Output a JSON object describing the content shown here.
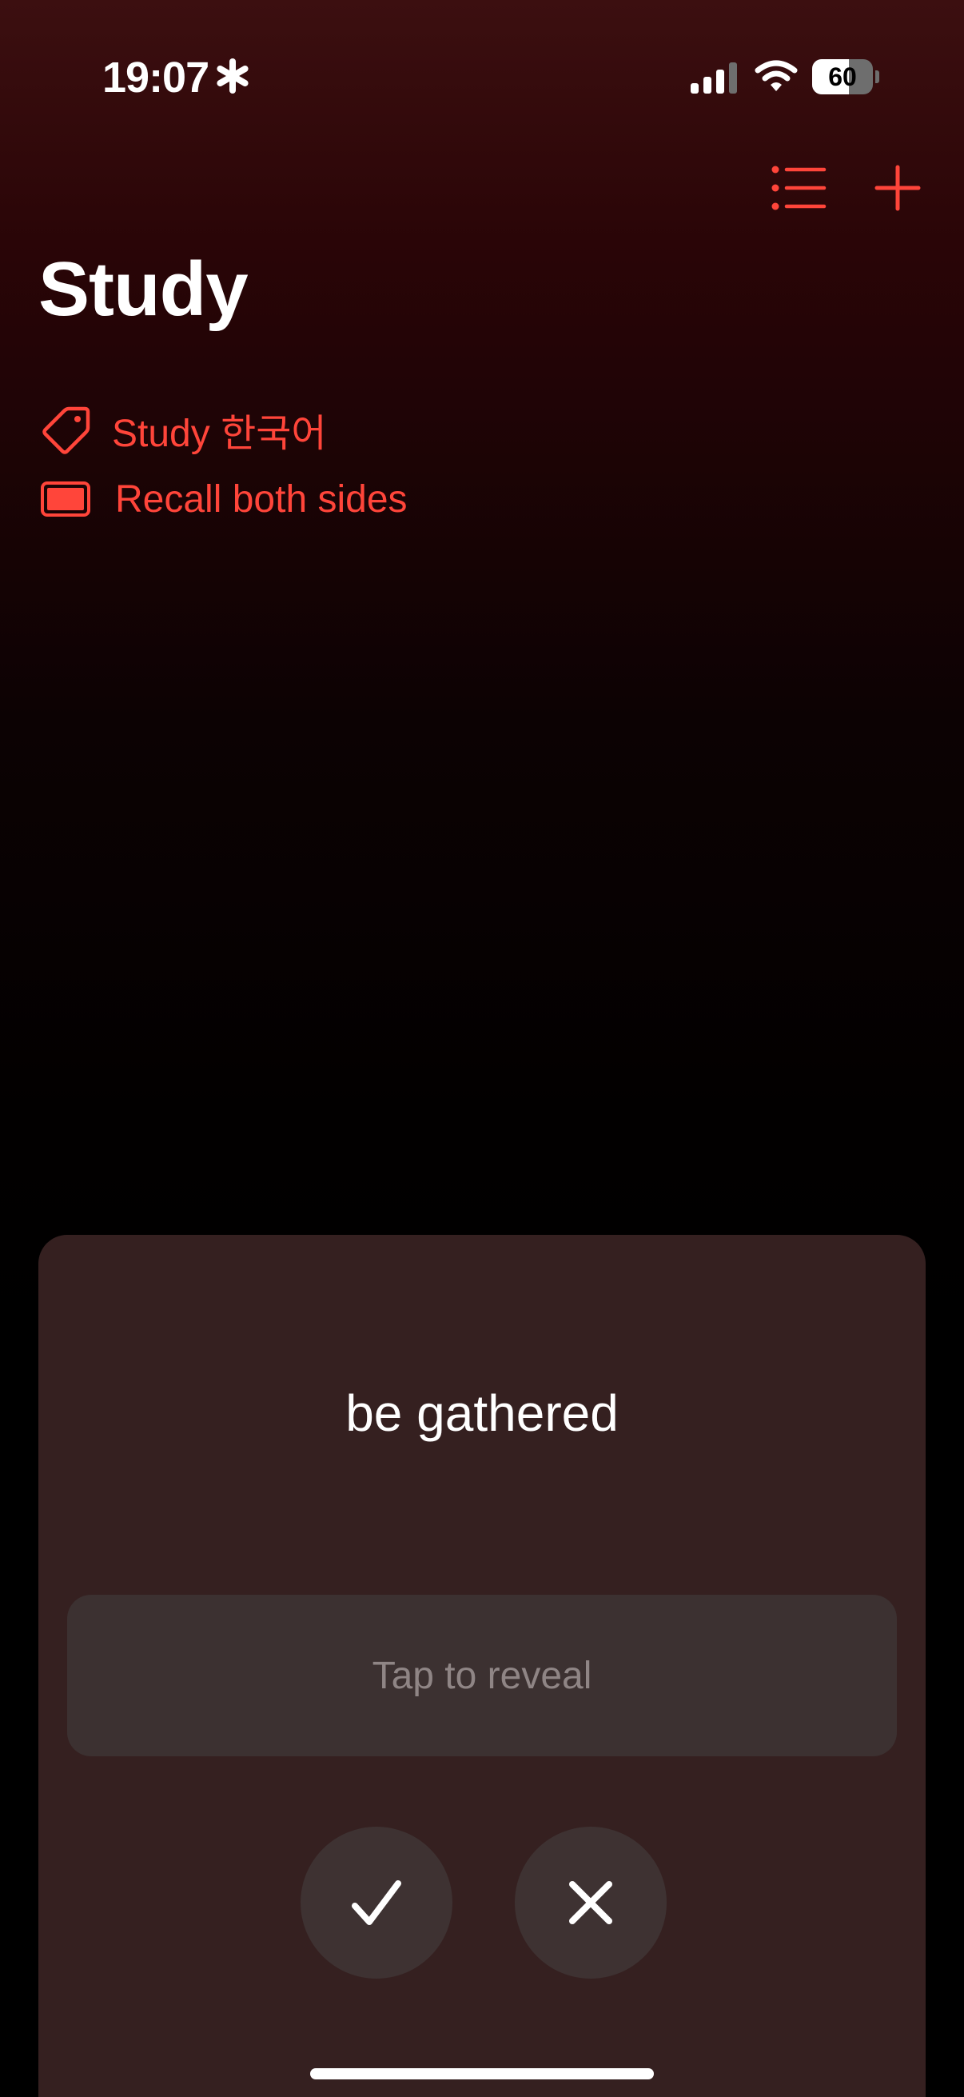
{
  "status_bar": {
    "time": "19:07",
    "battery_level": 60,
    "battery_label": "60",
    "icons": [
      "asterisk-icon",
      "signal-icon",
      "wifi-icon",
      "battery-icon"
    ]
  },
  "nav": {
    "icons": [
      "list-icon",
      "plus-icon"
    ]
  },
  "header": {
    "title": "Study"
  },
  "links": {
    "deck": {
      "icon": "tag-icon",
      "label": "Study 한국어"
    },
    "mode": {
      "icon": "card-icon",
      "label": "Recall both sides"
    }
  },
  "card": {
    "prompt": "be gathered",
    "reveal_label": "Tap to reveal",
    "actions": [
      "checkmark-icon",
      "xmark-icon"
    ]
  },
  "colors": {
    "accent": "#ff453a",
    "card_background": "#352020",
    "reveal_background": "#3c3131",
    "action_background": "#3e3232"
  }
}
